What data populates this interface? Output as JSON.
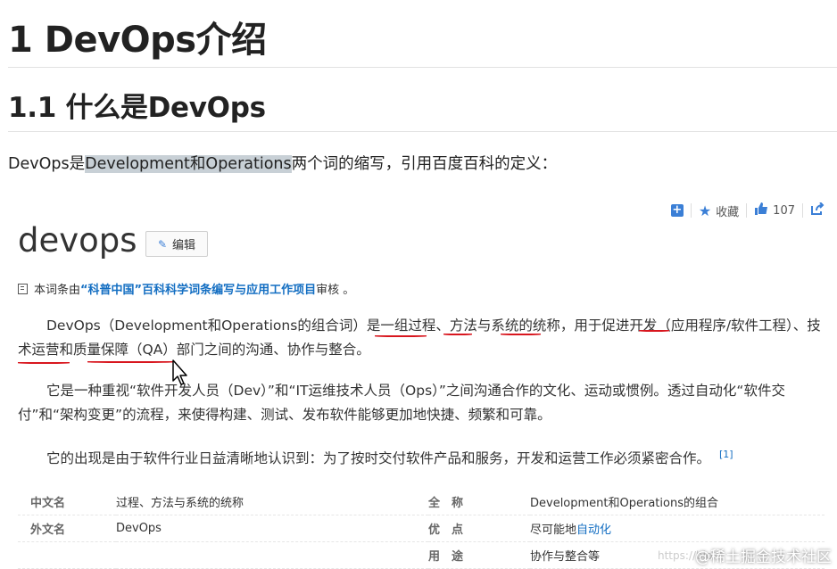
{
  "heading1": "1 DevOps介绍",
  "heading2": "1.1 什么是DevOps",
  "intro": {
    "pre": "DevOps是",
    "highlight": "Development和Operations",
    "post": "两个词的缩写，引用百度百科的定义："
  },
  "toolbar": {
    "favorite_label": "收藏",
    "like_count": "107"
  },
  "entry": {
    "term": "devops",
    "edit_label": "编辑",
    "review_pre": "本词条由",
    "review_link": "“科普中国”百科科学词条编写与应用工作项目",
    "review_post": " 审核 。"
  },
  "paragraphs": {
    "p1": "DevOps（Development和Operations的组合词）是一组过程、方法与系统的统称，用于促进开发（应用程序/软件工程）、技术运营和质量保障（QA）部门之间的沟通、协作与整合。",
    "p2": "它是一种重视“软件开发人员（Dev）”和“IT运维技术人员（Ops）”之间沟通合作的文化、运动或惯例。透过自动化“软件交付”和“架构变更”的流程，来使得构建、测试、发布软件能够更加地快捷、频繁和可靠。",
    "p3": "它的出现是由于软件行业日益清晰地认识到：为了按时交付软件产品和服务，开发和运营工作必须紧密合作。",
    "p3_ref": "[1]"
  },
  "infobox": {
    "rows": [
      {
        "k1": "中文名",
        "v1": "过程、方法与系统的统称",
        "k2": "全　称",
        "v2": "Development和Operations的组合"
      },
      {
        "k1": "外文名",
        "v1": "DevOps",
        "k2": "优　点",
        "v2_pre": "尽可能地",
        "v2_link": "自动化"
      },
      {
        "k1": "",
        "v1": "",
        "k2": "用　途",
        "v2": "协作与整合等"
      }
    ]
  },
  "watermark": "@稀土掘金技术社区",
  "watermark_url": "https://blo",
  "colors": {
    "link": "#136ec2",
    "highlight": "#c8d0d6",
    "annotation_red": "#d8161e",
    "icon_blue": "#3b7fd6"
  }
}
